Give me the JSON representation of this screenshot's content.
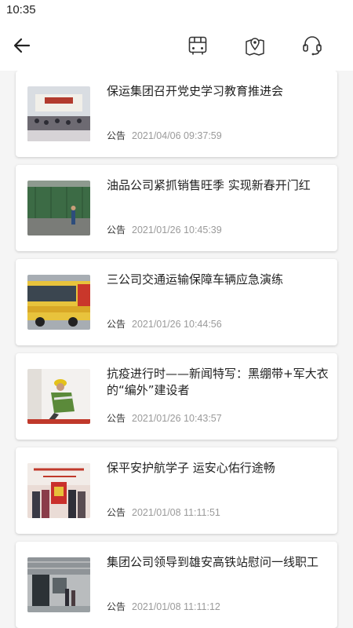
{
  "status_bar": {
    "time": "10:35"
  },
  "toolbar": {
    "back_icon": "arrow-left-icon",
    "bus_icon": "bus-icon",
    "map_icon": "map-pin-icon",
    "support_icon": "headset-icon"
  },
  "articles": [
    {
      "title": "保运集团召开党史学习教育推进会",
      "type": "公告",
      "date": "2021/04/06 09:37:59"
    },
    {
      "title": "油品公司紧抓销售旺季 实现新春开门红",
      "type": "公告",
      "date": "2021/01/26 10:45:39"
    },
    {
      "title": "三公司交通运输保障车辆应急演练",
      "type": "公告",
      "date": "2021/01/26 10:44:56"
    },
    {
      "title": "抗疫进行时——新闻特写：黑绷带+军大衣的“编外”建设者",
      "type": "公告",
      "date": "2021/01/26 10:43:57"
    },
    {
      "title": "保平安护航学子 运安心佑行途畅",
      "type": "公告",
      "date": "2021/01/08 11:11:51"
    },
    {
      "title": "集团公司领导到雄安高铁站慰问一线职工",
      "type": "公告",
      "date": "2021/01/08 11:11:12"
    }
  ]
}
